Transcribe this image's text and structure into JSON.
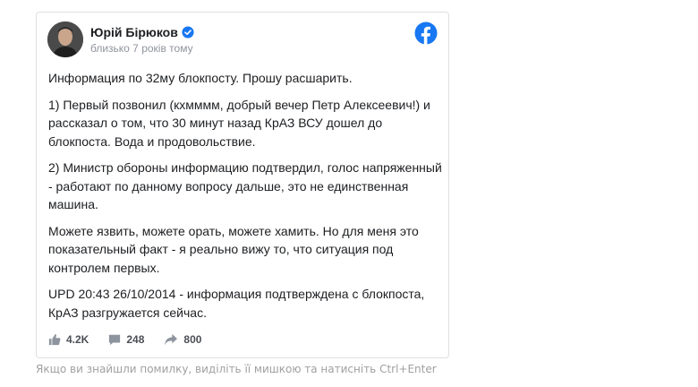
{
  "post": {
    "author": "Юрій Бірюков",
    "time": "близько 7 років тому",
    "paragraphs": [
      "Информация по 32му блокпосту. Прошу расшарить.",
      "1) Первый позвонил (кхмммм, добрый вечер Петр Алексеевич!) и рассказал о том, что 30 минут назад КрАЗ ВСУ дошел до блокпоста. Вода и продовольствие.",
      "2) Министр обороны информацию подтвердил, голос напряженный - работают по данному вопросу дальше, это не единственная машина.",
      "Можете язвить, можете орать, можете хамить. Но для меня это показательный факт - я реально вижу то, что ситуация под контролем первых.",
      "UPD 20:43 26/10/2014 - информация подтверждена с блокпоста, КрАЗ разгружается сейчас."
    ],
    "stats": {
      "likes": "4.2K",
      "comments": "248",
      "shares": "800"
    }
  },
  "hint": "Якщо ви знайшли помилку, виділіть її мишкою та натисніть Ctrl+Enter",
  "colors": {
    "brand": "#1877f2",
    "text": "#1c1e21",
    "muted": "#90949c",
    "border": "#dddfe2"
  },
  "icons": [
    "verified-badge-icon",
    "facebook-logo-icon",
    "like-icon",
    "comment-icon",
    "share-icon"
  ]
}
